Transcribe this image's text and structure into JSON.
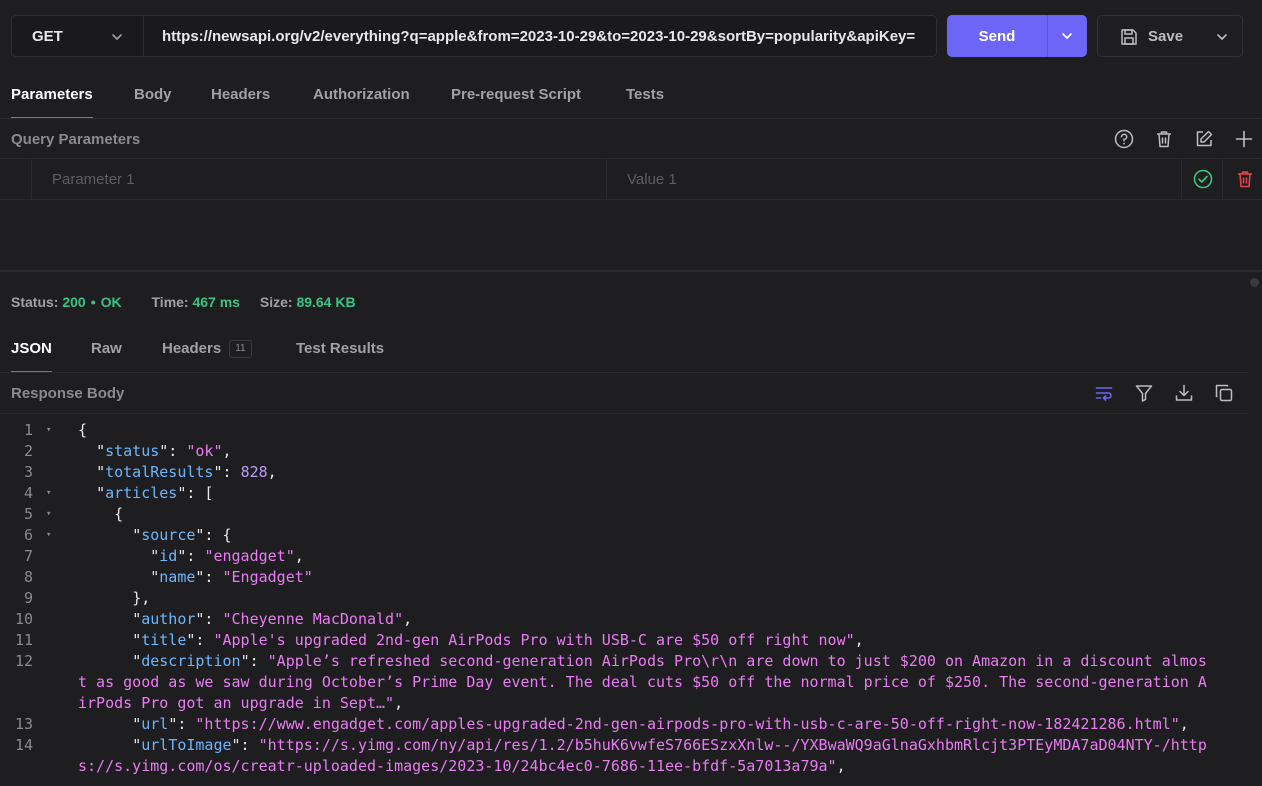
{
  "request": {
    "method": "GET",
    "url": "https://newsapi.org/v2/everything?q=apple&from=2023-10-29&to=2023-10-29&sortBy=popularity&apiKey=",
    "send_label": "Send",
    "save_label": "Save"
  },
  "request_tabs": [
    "Parameters",
    "Body",
    "Headers",
    "Authorization",
    "Pre-request Script",
    "Tests"
  ],
  "query": {
    "title": "Query Parameters",
    "param_placeholder": "Parameter 1",
    "value_placeholder": "Value 1"
  },
  "status": {
    "status_label": "Status:",
    "code": "200",
    "text": "OK",
    "time_label": "Time:",
    "time": "467 ms",
    "size_label": "Size:",
    "size": "89.64 KB"
  },
  "response_tabs": {
    "json": "JSON",
    "raw": "Raw",
    "headers": "Headers",
    "headers_count": "11",
    "tests": "Test Results"
  },
  "response": {
    "title": "Response Body"
  },
  "code_lines": [
    {
      "n": "1",
      "fold": true,
      "indent": 0,
      "parts": [
        [
          "p",
          "{"
        ]
      ]
    },
    {
      "n": "2",
      "fold": false,
      "indent": 1,
      "parts": [
        [
          "p",
          "\""
        ],
        [
          "k",
          "status"
        ],
        [
          "p",
          "\": "
        ],
        [
          "s",
          "\"ok\""
        ],
        [
          "p",
          ","
        ]
      ]
    },
    {
      "n": "3",
      "fold": false,
      "indent": 1,
      "parts": [
        [
          "p",
          "\""
        ],
        [
          "k",
          "totalResults"
        ],
        [
          "p",
          "\": "
        ],
        [
          "n",
          "828"
        ],
        [
          "p",
          ","
        ]
      ]
    },
    {
      "n": "4",
      "fold": true,
      "indent": 1,
      "parts": [
        [
          "p",
          "\""
        ],
        [
          "k",
          "articles"
        ],
        [
          "p",
          "\": ["
        ]
      ]
    },
    {
      "n": "5",
      "fold": true,
      "indent": 2,
      "parts": [
        [
          "p",
          "{"
        ]
      ]
    },
    {
      "n": "6",
      "fold": true,
      "indent": 3,
      "parts": [
        [
          "p",
          "\""
        ],
        [
          "k",
          "source"
        ],
        [
          "p",
          "\": {"
        ]
      ]
    },
    {
      "n": "7",
      "fold": false,
      "indent": 4,
      "parts": [
        [
          "p",
          "\""
        ],
        [
          "k",
          "id"
        ],
        [
          "p",
          "\": "
        ],
        [
          "s",
          "\"engadget\""
        ],
        [
          "p",
          ","
        ]
      ]
    },
    {
      "n": "8",
      "fold": false,
      "indent": 4,
      "parts": [
        [
          "p",
          "\""
        ],
        [
          "k",
          "name"
        ],
        [
          "p",
          "\": "
        ],
        [
          "s",
          "\"Engadget\""
        ]
      ]
    },
    {
      "n": "9",
      "fold": false,
      "indent": 3,
      "parts": [
        [
          "p",
          "},"
        ]
      ]
    },
    {
      "n": "10",
      "fold": false,
      "indent": 3,
      "parts": [
        [
          "p",
          "\""
        ],
        [
          "k",
          "author"
        ],
        [
          "p",
          "\": "
        ],
        [
          "s",
          "\"Cheyenne MacDonald\""
        ],
        [
          "p",
          ","
        ]
      ]
    },
    {
      "n": "11",
      "fold": false,
      "indent": 3,
      "parts": [
        [
          "p",
          "\""
        ],
        [
          "k",
          "title"
        ],
        [
          "p",
          "\": "
        ],
        [
          "s",
          "\"Apple's upgraded 2nd-gen AirPods Pro with USB-C are $50 off right now\""
        ],
        [
          "p",
          ","
        ]
      ]
    },
    {
      "n": "12",
      "fold": false,
      "indent": 3,
      "parts": [
        [
          "p",
          "\""
        ],
        [
          "k",
          "description"
        ],
        [
          "p",
          "\": "
        ],
        [
          "s",
          "\"Apple’s refreshed second-generation AirPods Pro\\r\\n are down to just $200 on Amazon in a discount almost as good as we saw during October’s Prime Day event. The deal cuts $50 off the normal price of $250. The second-generation AirPods Pro got an upgrade in Sept…\""
        ],
        [
          "p",
          ","
        ]
      ]
    },
    {
      "n": "13",
      "fold": false,
      "indent": 3,
      "parts": [
        [
          "p",
          "\""
        ],
        [
          "k",
          "url"
        ],
        [
          "p",
          "\": "
        ],
        [
          "s",
          "\"https://www.engadget.com/apples-upgraded-2nd-gen-airpods-pro-with-usb-c-are-50-off-right-now-182421286.html\""
        ],
        [
          "p",
          ","
        ]
      ]
    },
    {
      "n": "14",
      "fold": false,
      "indent": 3,
      "parts": [
        [
          "p",
          "\""
        ],
        [
          "k",
          "urlToImage"
        ],
        [
          "p",
          "\": "
        ],
        [
          "s",
          "\"https://s.yimg.com/ny/api/res/1.2/b5huK6vwfeS766ESzxXnlw--/YXBwaWQ9aGlnaGxhbmRlcjt3PTEyMDA7aD04NTY-/https://s.yimg.com/os/creatr-uploaded-images/2023-10/24bc4ec0-7686-11ee-bfdf-5a7013a79a\""
        ],
        [
          "p",
          ","
        ]
      ]
    }
  ],
  "colors": {
    "accent": "#6d65f6",
    "success": "#37c480",
    "danger": "#e5484d",
    "json_key": "#6cb6ff",
    "json_string": "#e97cf2",
    "json_number": "#b99cf5"
  },
  "icons": {
    "help": "help-circle-icon",
    "trash": "trash-icon",
    "edit": "edit-icon",
    "add": "plus-icon",
    "check": "check-circle-icon",
    "wrap": "word-wrap-icon",
    "filter": "filter-icon",
    "download": "download-icon",
    "copy": "copy-icon",
    "save": "save-icon"
  }
}
